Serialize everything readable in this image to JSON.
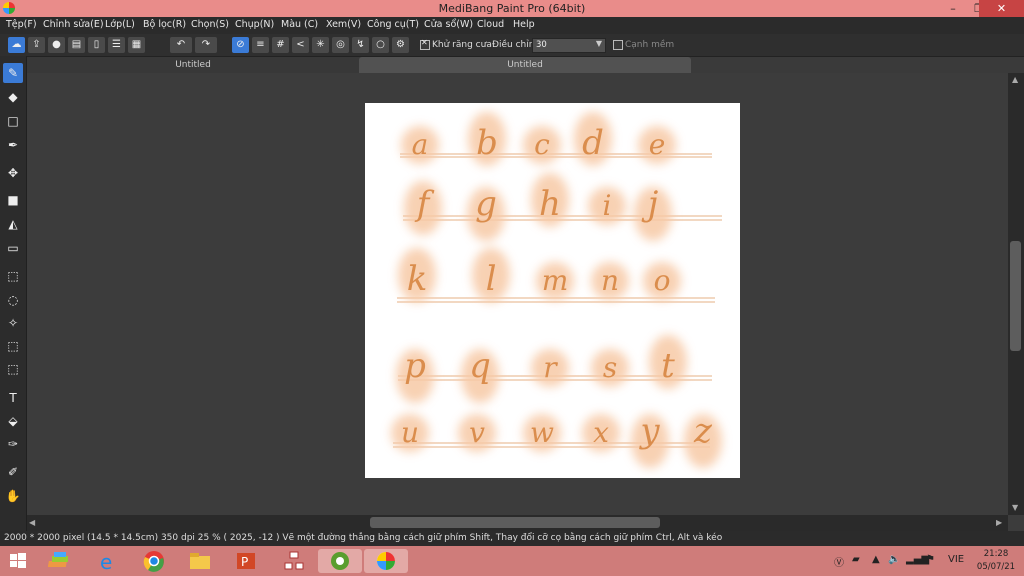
{
  "window": {
    "title": "MediBang Paint Pro (64bit)",
    "minimize": "–",
    "restore": "❐",
    "close": "✕"
  },
  "menu": [
    "Tệp(F)",
    "Chỉnh sửa(E)",
    "Lớp(L)",
    "Bộ lọc(R)",
    "Chọn(S)",
    "Chụp(N)",
    "Màu (C)",
    "Xem(V)",
    "Công cụ(T)",
    "Cửa sổ(W)",
    "Cloud",
    "Help"
  ],
  "toolbar": {
    "antialias_label": "Khử răng cưa",
    "antialias_checked": true,
    "correction_label": "Điều chỉnh",
    "correction_value": "30",
    "smooth_label": "Cạnh mềm",
    "smooth_checked": false
  },
  "tabs": [
    "Untitled",
    "Untitled"
  ],
  "canvas": {
    "background": "#3c3c3c",
    "paper": "#ffffff",
    "stroke_color": "#d98a48",
    "glow_color": "#f7c9a6"
  },
  "letters": [
    [
      "a",
      "b",
      "c",
      "d",
      "e"
    ],
    [
      "f",
      "g",
      "h",
      "i",
      "j"
    ],
    [
      "k",
      "l",
      "m",
      "n",
      "o"
    ],
    [
      "p",
      "q",
      "r",
      "s",
      "t"
    ],
    [
      "u",
      "v",
      "w",
      "x",
      "y",
      "z"
    ]
  ],
  "status": "2000 * 2000 pixel   (14.5 * 14.5cm)   350 dpi   25 %   ( 2025, -12 )   Vẽ một đường thẳng bằng cách giữ phím Shift, Thay đổi cỡ cọ bằng cách giữ phím Ctrl, Alt và kéo",
  "tray": {
    "lang": "VIE",
    "time": "21:28",
    "date": "05/07/21"
  },
  "colors": {
    "titlebar": "#e98c8a",
    "taskbar": "#cf7c7a",
    "accent": "#3b7bd6"
  }
}
